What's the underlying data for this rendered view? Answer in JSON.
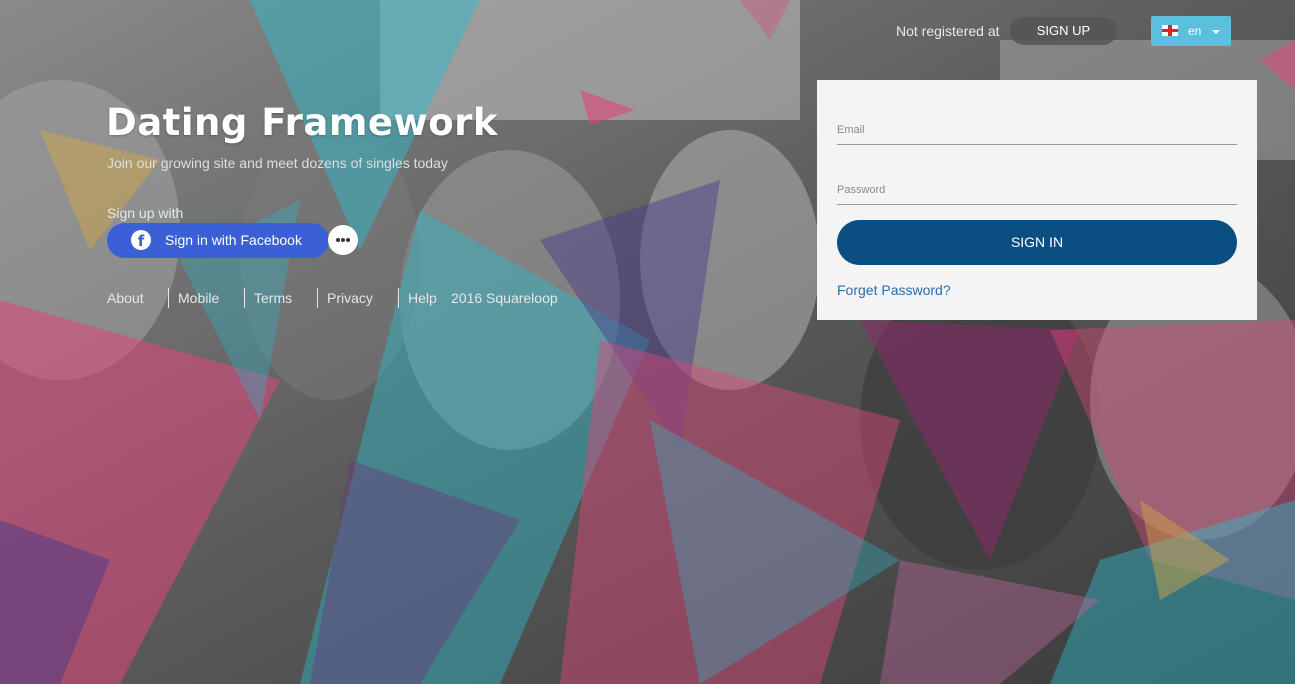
{
  "header": {
    "not_registered_text": "Not registered at",
    "signup_label": "SIGN UP",
    "language": {
      "code": "en",
      "flag_icon": "england-flag-icon"
    }
  },
  "hero": {
    "title": "Dating Framework",
    "subtitle": "Join our growing site and meet dozens of singles today",
    "signup_with": "Sign up with",
    "facebook_label": "Sign in with Facebook",
    "more_icon": "more-options-icon"
  },
  "footer": {
    "links": [
      "About",
      "Mobile",
      "Terms",
      "Privacy",
      "Help"
    ],
    "copyright": "2016 Squareloop"
  },
  "login": {
    "email_label": "Email",
    "password_label": "Password",
    "signin_label": "SIGN IN",
    "forgot_label": "Forget Password?"
  },
  "colors": {
    "accent": "#0b4f82",
    "facebook": "#3b5fd6",
    "language_button": "#5bc0de",
    "link": "#2a6ea8"
  }
}
